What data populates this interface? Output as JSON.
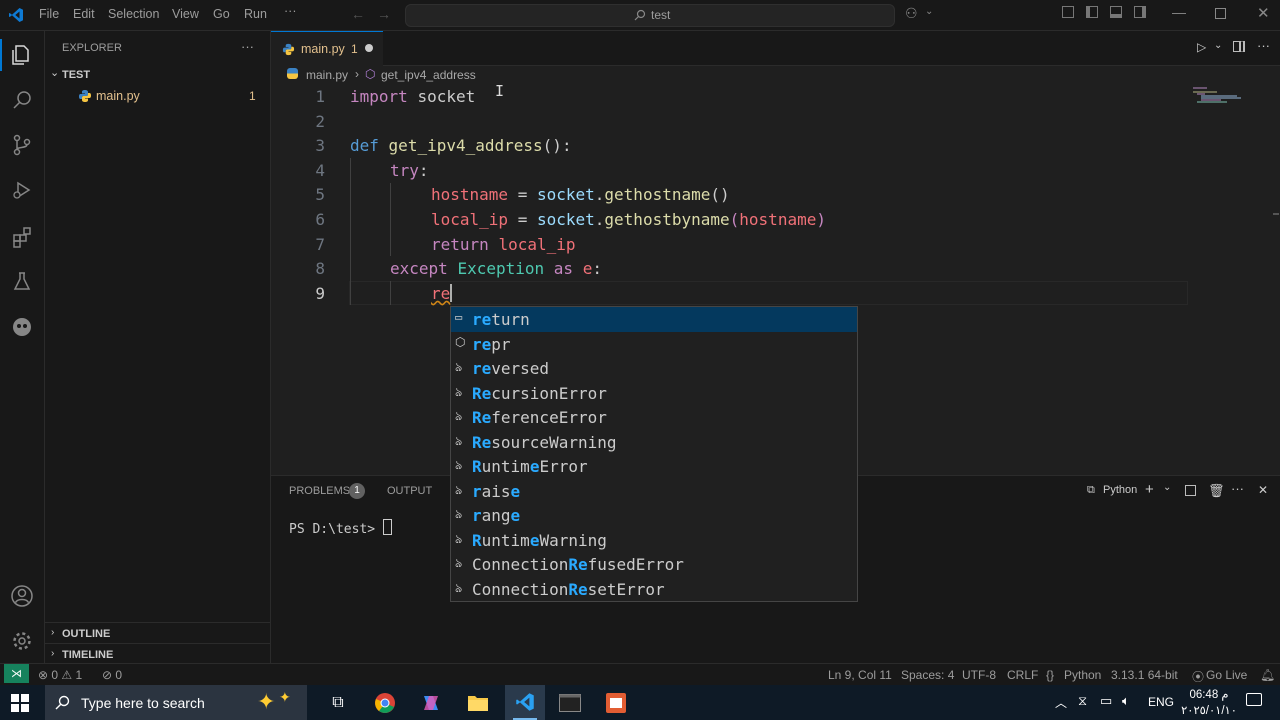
{
  "titlebar": {
    "menu": [
      "File",
      "Edit",
      "Selection",
      "View",
      "Go",
      "Run",
      "···"
    ],
    "search_text": "test"
  },
  "sidebar": {
    "header": "EXPLORER",
    "more": "···",
    "folder": "TEST",
    "file": "main.py",
    "file_badge": "1",
    "outline": "OUTLINE",
    "timeline": "TIMELINE"
  },
  "editor": {
    "tab_label": "main.py",
    "tab_badge": "1",
    "breadcrumb_file": "main.py",
    "breadcrumb_symbol": "get_ipv4_address",
    "line_numbers": [
      "1",
      "2",
      "3",
      "4",
      "5",
      "6",
      "7",
      "8",
      "9"
    ]
  },
  "code": {
    "l1_kw": "import",
    "l1_mod": "socket",
    "l3_def": "def",
    "l3_fn": "get_ipv4_address",
    "l3_rest": "():",
    "l4_try": "try",
    "l4_colon": ":",
    "l5_var": "hostname",
    "l5_eq": " = ",
    "l5_obj": "socket",
    "l5_dot": ".",
    "l5_fn": "gethostname",
    "l5_par": "()",
    "l6_var": "local_ip",
    "l6_eq": " = ",
    "l6_obj": "socket",
    "l6_dot": ".",
    "l6_fn": "gethostbyname",
    "l6_p1": "(",
    "l6_arg": "hostname",
    "l6_p2": ")",
    "l7_ret": "return",
    "l7_var": "local_ip",
    "l8_exc": "except",
    "l8_cls": "Exception",
    "l8_as": "as",
    "l8_var": "e",
    "l8_colon": ":",
    "l9_typed": "re"
  },
  "suggest": [
    {
      "m": "re",
      "r": "turn",
      "icon": "keyword"
    },
    {
      "m": "re",
      "r": "pr",
      "icon": "method"
    },
    {
      "m": "re",
      "r": "versed",
      "icon": "class"
    },
    {
      "m": "Re",
      "r": "cursionError",
      "icon": "class"
    },
    {
      "m": "Re",
      "r": "ferenceError",
      "icon": "class"
    },
    {
      "m": "Re",
      "r": "sourceWarning",
      "icon": "class"
    },
    {
      "m": "R",
      "r": "untim",
      "m2": "e",
      "r2": "Error",
      "icon": "class"
    },
    {
      "m": "r",
      "r": "ais",
      "m2": "e",
      "r2": "",
      "icon": "class"
    },
    {
      "m": "r",
      "r": "ang",
      "m2": "e",
      "r2": "",
      "icon": "class"
    },
    {
      "m": "R",
      "r": "untim",
      "m2": "e",
      "r2": "Warning",
      "icon": "class"
    },
    {
      "p": "Connection",
      "m": "Re",
      "r": "fusedError",
      "icon": "class"
    },
    {
      "p": "Connection",
      "m": "Re",
      "r": "setError",
      "icon": "class"
    }
  ],
  "panel": {
    "problems": "PROBLEMS",
    "problems_count": "1",
    "output": "OUTPUT",
    "terminal_type": "Python",
    "prompt": "PS D:\\test> "
  },
  "status": {
    "errors": "0",
    "warnings": "1",
    "ports": "0",
    "position": "Ln 9, Col 11",
    "spaces": "Spaces: 4",
    "encoding": "UTF-8",
    "eol": "CRLF",
    "language": "Python",
    "interpreter": "3.13.1 64-bit",
    "golive": "Go Live"
  },
  "taskbar": {
    "search_placeholder": "Type here to search",
    "lang": "ENG",
    "time": "06:48 م",
    "date": "٢٠٢٥/٠١/١٠"
  },
  "colors": {
    "accent": "#0078d4",
    "match": "#2aaaff",
    "selected": "#04395e"
  }
}
